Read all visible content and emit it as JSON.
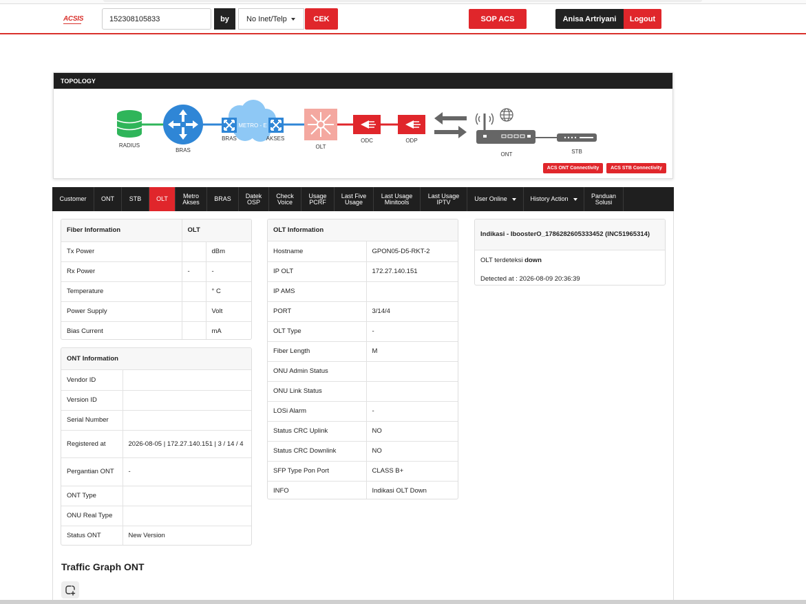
{
  "navbar": {
    "logo": "ACSIS",
    "search_value": "152308105833",
    "by_label": "by",
    "select_value": "No Inet/Telp",
    "cek_label": "CEK",
    "sop_label": "SOP ACS",
    "user_name": "Anisa Artriyani",
    "logout_label": "Logout"
  },
  "topology": {
    "title": "TOPOLOGY",
    "nodes": {
      "radius": "RADIUS",
      "bras": "BRAS",
      "bras2": "BRAS",
      "metro": "METRO - E",
      "akses": "AKSES",
      "olt": "OLT",
      "odc": "ODC",
      "odp": "ODP",
      "ont": "ONT",
      "stb": "STB"
    },
    "ont_conn_label": "ACS ONT Connectivity",
    "stb_conn_label": "ACS STB Connectivity"
  },
  "tabs": [
    {
      "l1": "Customer",
      "l2": ""
    },
    {
      "l1": "ONT",
      "l2": ""
    },
    {
      "l1": "STB",
      "l2": ""
    },
    {
      "l1": "OLT",
      "l2": ""
    },
    {
      "l1": "Metro",
      "l2": "Akses"
    },
    {
      "l1": "BRAS",
      "l2": ""
    },
    {
      "l1": "Datek",
      "l2": "OSP"
    },
    {
      "l1": "Check",
      "l2": "Voice"
    },
    {
      "l1": "Usage",
      "l2": "PCRF"
    },
    {
      "l1": "Last Five",
      "l2": "Usage"
    },
    {
      "l1": "Last Usage",
      "l2": "Minitools"
    },
    {
      "l1": "Last Usage",
      "l2": "IPTV"
    },
    {
      "l1": "User Online",
      "l2": ""
    },
    {
      "l1": "History Action",
      "l2": ""
    },
    {
      "l1": "Panduan",
      "l2": "Solusi"
    }
  ],
  "fiber": {
    "h1": "Fiber Information",
    "h2": "OLT",
    "rows": [
      {
        "label": "Tx Power",
        "value": "",
        "unit": "dBm"
      },
      {
        "label": "Rx Power",
        "value": "-",
        "unit": "-"
      },
      {
        "label": "Temperature",
        "value": "",
        "unit": "° C"
      },
      {
        "label": "Power Supply",
        "value": "",
        "unit": "Volt"
      },
      {
        "label": "Bias Current",
        "value": "",
        "unit": "mA"
      }
    ]
  },
  "ont_info": {
    "title": "ONT Information",
    "rows": [
      {
        "label": "Vendor ID",
        "value": ""
      },
      {
        "label": "Version ID",
        "value": ""
      },
      {
        "label": "Serial Number",
        "value": ""
      },
      {
        "label": "Registered at",
        "value": "2026-08-05 | 172.27.140.151 | 3 / 14 / 4"
      },
      {
        "label": "Pergantian ONT",
        "value": "-"
      },
      {
        "label": "ONT Type",
        "value": ""
      },
      {
        "label": "ONU Real Type",
        "value": ""
      },
      {
        "label": "Status ONT",
        "value": "New Version"
      }
    ]
  },
  "olt_info": {
    "title": "OLT Information",
    "rows": [
      {
        "label": "Hostname",
        "value": "GPON05-D5-RKT-2"
      },
      {
        "label": "IP OLT",
        "value": "172.27.140.151"
      },
      {
        "label": "IP AMS",
        "value": ""
      },
      {
        "label": "PORT",
        "value": "3/14/4"
      },
      {
        "label": "OLT Type",
        "value": "-"
      },
      {
        "label": "Fiber Length",
        "value": "M"
      },
      {
        "label": "ONU Admin Status",
        "value": ""
      },
      {
        "label": "ONU Link Status",
        "value": ""
      },
      {
        "label": "LOSi Alarm",
        "value": "-"
      },
      {
        "label": "Status CRC Uplink",
        "value": "NO"
      },
      {
        "label": "Status CRC Downlink",
        "value": "NO"
      },
      {
        "label": "SFP Type Pon Port",
        "value": "CLASS B+"
      },
      {
        "label": "INFO",
        "value": "Indikasi OLT Down"
      }
    ]
  },
  "indikasi": {
    "title": "Indikasi - IboosterO_1786282605333452 (INC51965314)",
    "status_prefix": "OLT terdeteksi ",
    "status_value": "down",
    "detected": "Detected at : 2026-08-09 20:36:39"
  },
  "traffic": {
    "title": "Traffic Graph ONT"
  },
  "colors": {
    "brand_red": "#e0262b",
    "dark": "#1f1f1f",
    "green": "#2fb55a",
    "blue": "#2f86d6"
  }
}
